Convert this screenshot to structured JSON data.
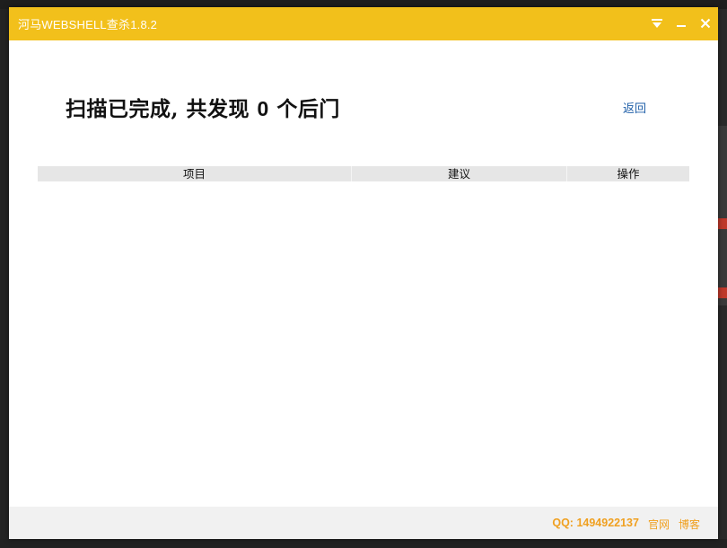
{
  "window": {
    "title": "河马WEBSHELL查杀1.8.2",
    "accent_color": "#f2c01b",
    "controls": [
      "menu-icon",
      "minimize-icon",
      "close-icon"
    ]
  },
  "result": {
    "prefix": "扫描已完成, 共发现",
    "count": "0",
    "suffix": "个后门",
    "back_label": "返回",
    "link_color": "#1f5fa8"
  },
  "table": {
    "columns": [
      "项目",
      "建议",
      "操作"
    ],
    "rows": []
  },
  "footer": {
    "qq": "QQ: 1494922137",
    "site_label": "官网",
    "blog_label": "博客",
    "text_color": "#f0a020"
  }
}
